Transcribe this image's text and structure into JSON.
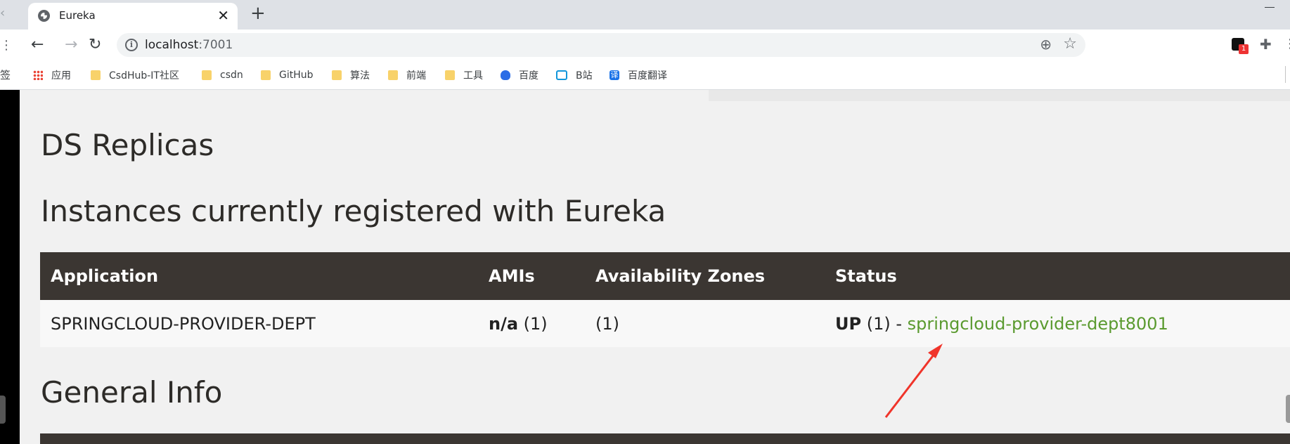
{
  "browser": {
    "tab_title": "Eureka",
    "url_host": "localhost",
    "url_port": ":7001",
    "extension_badge": "1"
  },
  "bookmarks": {
    "edge_label": "签",
    "items": [
      {
        "label": "应用",
        "icon": "apps-icon"
      },
      {
        "label": "CsdHub-IT社区",
        "icon": "folder-icon"
      },
      {
        "label": "csdn",
        "icon": "folder-icon"
      },
      {
        "label": "GitHub",
        "icon": "folder-icon"
      },
      {
        "label": "算法",
        "icon": "folder-icon"
      },
      {
        "label": "前端",
        "icon": "folder-icon"
      },
      {
        "label": "工具",
        "icon": "folder-icon"
      },
      {
        "label": "百度",
        "icon": "baidu-icon"
      },
      {
        "label": "B站",
        "icon": "bilibili-icon"
      },
      {
        "label": "百度翻译",
        "icon": "translate-icon"
      }
    ]
  },
  "page": {
    "ds_replicas_heading": "DS Replicas",
    "instances_heading": "Instances currently registered with Eureka",
    "general_info_heading": "General Info",
    "table": {
      "headers": [
        "Application",
        "AMIs",
        "Availability Zones",
        "Status"
      ],
      "row": {
        "application": "SPRINGCLOUD-PROVIDER-DEPT",
        "amis_value": "n/a",
        "amis_count": " (1)",
        "zones": "(1)",
        "status_state": "UP",
        "status_count": " (1) - ",
        "status_link": "springcloud-provider-dept8001"
      }
    }
  },
  "annotation": {
    "arrow_color": "#f0342a"
  },
  "colors": {
    "table_header": "#3b3632",
    "link_green": "#5a9a2f",
    "page_bg": "#f1f1f1"
  }
}
